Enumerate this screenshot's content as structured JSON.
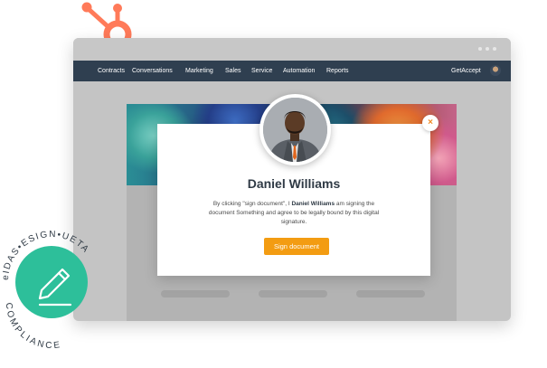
{
  "nav": {
    "items": [
      "Contracts",
      "Conversations",
      "Marketing",
      "Sales",
      "Service",
      "Automation",
      "Reports"
    ],
    "brand": "GetAccept"
  },
  "modal": {
    "signer_name": "Daniel Williams",
    "text_before": "By clicking \"sign document\", I ",
    "text_name": "Daniel Williams",
    "text_after": " am signing the document Something and agree to be legally bound by this digital signature.",
    "sign_button_label": "Sign document",
    "close_label": "×"
  },
  "badge": {
    "top_text": "eIDAS•ESIGN•UETA",
    "bottom_text": "COMPLIANCE"
  },
  "colors": {
    "hubspot_orange": "#ff7a59",
    "navbar": "#2f3f50",
    "accent_button": "#f39c12",
    "badge_green": "#2dbf9a"
  },
  "icons": [
    "hubspot-logo-icon",
    "close-icon",
    "pen-icon"
  ]
}
